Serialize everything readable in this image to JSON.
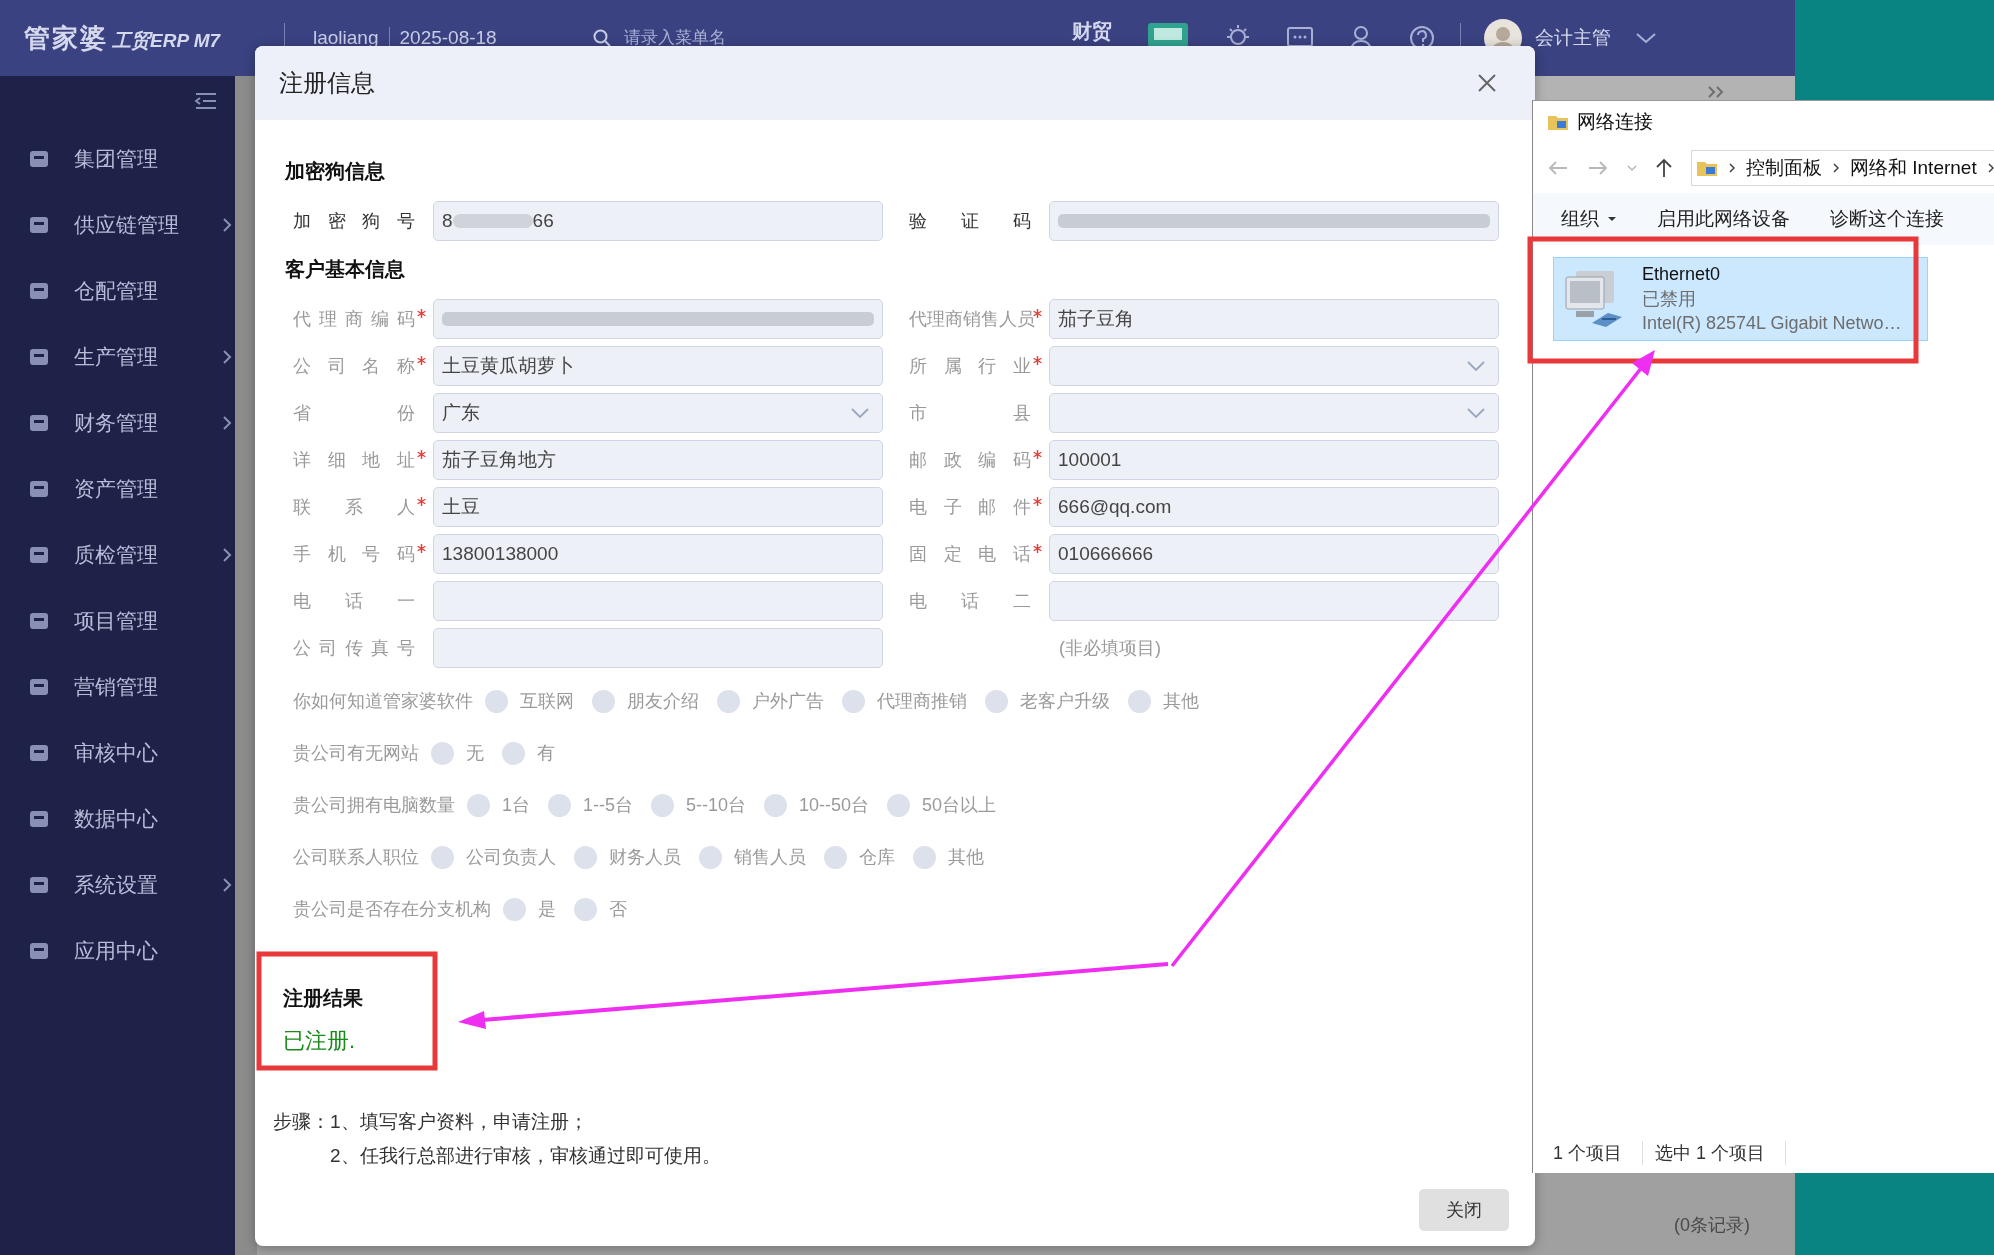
{
  "topbar": {
    "logo_main": "管家婆",
    "logo_sub": "工贸ERP M7",
    "user": "laoliang",
    "date": "2025-08-18",
    "search": {
      "placeholder": "请录入菜单名"
    },
    "badge": "财贸",
    "account": "会计主管"
  },
  "sidebar": {
    "items": [
      {
        "label": "集团管理",
        "expandable": false
      },
      {
        "label": "供应链管理",
        "expandable": true
      },
      {
        "label": "仓配管理",
        "expandable": false
      },
      {
        "label": "生产管理",
        "expandable": true
      },
      {
        "label": "财务管理",
        "expandable": true
      },
      {
        "label": "资产管理",
        "expandable": false
      },
      {
        "label": "质检管理",
        "expandable": true
      },
      {
        "label": "项目管理",
        "expandable": false
      },
      {
        "label": "营销管理",
        "expandable": false
      },
      {
        "label": "审核中心",
        "expandable": false
      },
      {
        "label": "数据中心",
        "expandable": false
      },
      {
        "label": "系统设置",
        "expandable": true
      },
      {
        "label": "应用中心",
        "expandable": false
      }
    ]
  },
  "background": {
    "record_count": "(0条记录)"
  },
  "dialog": {
    "title": "注册信息",
    "sections": [
      {
        "title": "加密狗信息",
        "kind": "dongle",
        "rows": [
          [
            {
              "label": "加密狗号",
              "required": false,
              "kind": "partly_blurred",
              "value_start": "8",
              "value_end": "66"
            },
            {
              "label": "验证码",
              "required": false,
              "kind": "blurred"
            }
          ]
        ]
      },
      {
        "title": "客户基本信息",
        "kind": "customer",
        "rows": [
          [
            {
              "label": "代理商编码",
              "required": true,
              "kind": "blurred"
            },
            {
              "label": "代理商销售人员",
              "required": true,
              "kind": "text",
              "value": "茄子豆角"
            }
          ],
          [
            {
              "label": "公司名称",
              "required": true,
              "kind": "text",
              "value": "土豆黄瓜胡萝卜"
            },
            {
              "label": "所属行业",
              "required": true,
              "kind": "select"
            }
          ],
          [
            {
              "label": "省份",
              "required": false,
              "kind": "select",
              "value": "广东"
            },
            {
              "label": "市县",
              "required": false,
              "kind": "select"
            }
          ],
          [
            {
              "label": "详细地址",
              "required": true,
              "kind": "text",
              "value": "茄子豆角地方"
            },
            {
              "label": "邮政编码",
              "required": true,
              "kind": "text",
              "value": "100001"
            }
          ],
          [
            {
              "label": "联系人",
              "required": true,
              "kind": "text",
              "value": "土豆"
            },
            {
              "label": "电子邮件",
              "required": true,
              "kind": "text",
              "value": "666@qq.com"
            }
          ],
          [
            {
              "label": "手机号码",
              "required": true,
              "kind": "text",
              "value": "13800138000"
            },
            {
              "label": "固定电话",
              "required": true,
              "kind": "text",
              "value": "010666666"
            }
          ],
          [
            {
              "label": "电话一",
              "required": false,
              "kind": "text"
            },
            {
              "label": "电话二",
              "required": false,
              "kind": "text"
            }
          ],
          [
            {
              "label": "公司传真号",
              "required": false,
              "kind": "text"
            },
            {
              "kind": "note",
              "text": "(非必填项目)"
            }
          ]
        ]
      }
    ],
    "questions": [
      {
        "label": "你如何知道管家婆软件",
        "options": [
          {
            "label": "互联网",
            "selected": false
          },
          {
            "label": "朋友介绍",
            "selected": false
          },
          {
            "label": "户外广告",
            "selected": false
          },
          {
            "label": "代理商推销",
            "selected": false
          },
          {
            "label": "老客户升级",
            "selected": false
          },
          {
            "label": "其他",
            "selected": false
          }
        ]
      },
      {
        "label": "贵公司有无网站",
        "options": [
          {
            "label": "无",
            "selected": false
          },
          {
            "label": "有",
            "selected": false
          }
        ]
      },
      {
        "label": "贵公司拥有电脑数量",
        "options": [
          {
            "label": "1台",
            "selected": false
          },
          {
            "label": "1--5台",
            "selected": false
          },
          {
            "label": "5--10台",
            "selected": false
          },
          {
            "label": "10--50台",
            "selected": false
          },
          {
            "label": "50台以上",
            "selected": false
          }
        ]
      },
      {
        "label": "公司联系人职位",
        "options": [
          {
            "label": "公司负责人",
            "selected": false
          },
          {
            "label": "财务人员",
            "selected": false
          },
          {
            "label": "销售人员",
            "selected": false
          },
          {
            "label": "仓库",
            "selected": false
          },
          {
            "label": "其他",
            "selected": false
          }
        ]
      },
      {
        "label": "贵公司是否存在分支机构",
        "options": [
          {
            "label": "是",
            "selected": false
          },
          {
            "label": "否",
            "selected": false
          }
        ]
      }
    ],
    "result": {
      "title": "注册结果",
      "status": "已注册."
    },
    "steps": {
      "label": "步骤：",
      "items": [
        "1、填写客户资料，申请注册；",
        "2、任我行总部进行审核，审核通过即可使用。"
      ]
    },
    "close_button": "关闭"
  },
  "explorer": {
    "title": "网络连接",
    "breadcrumb": [
      "控制面板",
      "网络和 Internet"
    ],
    "toolbar": [
      {
        "label": "组织",
        "dropdown": true
      },
      {
        "label": "启用此网络设备",
        "dropdown": false
      },
      {
        "label": "诊断这个连接",
        "dropdown": false
      }
    ],
    "items": [
      {
        "name": "Ethernet0",
        "status": "已禁用",
        "device": "Intel(R) 82574L Gigabit Netwo…",
        "selected": true
      }
    ],
    "status": [
      "1 个项目",
      "选中 1 个项目"
    ]
  }
}
